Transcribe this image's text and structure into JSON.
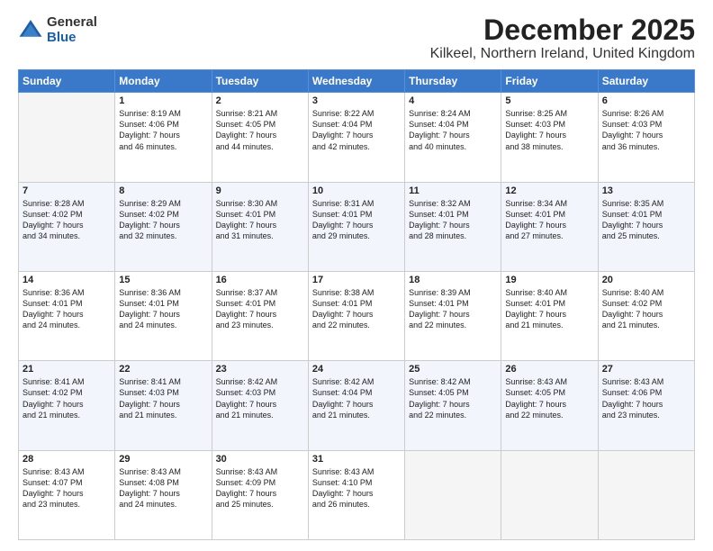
{
  "logo": {
    "general": "General",
    "blue": "Blue"
  },
  "header": {
    "title": "December 2025",
    "subtitle": "Kilkeel, Northern Ireland, United Kingdom"
  },
  "weekdays": [
    "Sunday",
    "Monday",
    "Tuesday",
    "Wednesday",
    "Thursday",
    "Friday",
    "Saturday"
  ],
  "weeks": [
    [
      {
        "day": "",
        "info": ""
      },
      {
        "day": "1",
        "info": "Sunrise: 8:19 AM\nSunset: 4:06 PM\nDaylight: 7 hours\nand 46 minutes."
      },
      {
        "day": "2",
        "info": "Sunrise: 8:21 AM\nSunset: 4:05 PM\nDaylight: 7 hours\nand 44 minutes."
      },
      {
        "day": "3",
        "info": "Sunrise: 8:22 AM\nSunset: 4:04 PM\nDaylight: 7 hours\nand 42 minutes."
      },
      {
        "day": "4",
        "info": "Sunrise: 8:24 AM\nSunset: 4:04 PM\nDaylight: 7 hours\nand 40 minutes."
      },
      {
        "day": "5",
        "info": "Sunrise: 8:25 AM\nSunset: 4:03 PM\nDaylight: 7 hours\nand 38 minutes."
      },
      {
        "day": "6",
        "info": "Sunrise: 8:26 AM\nSunset: 4:03 PM\nDaylight: 7 hours\nand 36 minutes."
      }
    ],
    [
      {
        "day": "7",
        "info": "Sunrise: 8:28 AM\nSunset: 4:02 PM\nDaylight: 7 hours\nand 34 minutes."
      },
      {
        "day": "8",
        "info": "Sunrise: 8:29 AM\nSunset: 4:02 PM\nDaylight: 7 hours\nand 32 minutes."
      },
      {
        "day": "9",
        "info": "Sunrise: 8:30 AM\nSunset: 4:01 PM\nDaylight: 7 hours\nand 31 minutes."
      },
      {
        "day": "10",
        "info": "Sunrise: 8:31 AM\nSunset: 4:01 PM\nDaylight: 7 hours\nand 29 minutes."
      },
      {
        "day": "11",
        "info": "Sunrise: 8:32 AM\nSunset: 4:01 PM\nDaylight: 7 hours\nand 28 minutes."
      },
      {
        "day": "12",
        "info": "Sunrise: 8:34 AM\nSunset: 4:01 PM\nDaylight: 7 hours\nand 27 minutes."
      },
      {
        "day": "13",
        "info": "Sunrise: 8:35 AM\nSunset: 4:01 PM\nDaylight: 7 hours\nand 25 minutes."
      }
    ],
    [
      {
        "day": "14",
        "info": "Sunrise: 8:36 AM\nSunset: 4:01 PM\nDaylight: 7 hours\nand 24 minutes."
      },
      {
        "day": "15",
        "info": "Sunrise: 8:36 AM\nSunset: 4:01 PM\nDaylight: 7 hours\nand 24 minutes."
      },
      {
        "day": "16",
        "info": "Sunrise: 8:37 AM\nSunset: 4:01 PM\nDaylight: 7 hours\nand 23 minutes."
      },
      {
        "day": "17",
        "info": "Sunrise: 8:38 AM\nSunset: 4:01 PM\nDaylight: 7 hours\nand 22 minutes."
      },
      {
        "day": "18",
        "info": "Sunrise: 8:39 AM\nSunset: 4:01 PM\nDaylight: 7 hours\nand 22 minutes."
      },
      {
        "day": "19",
        "info": "Sunrise: 8:40 AM\nSunset: 4:01 PM\nDaylight: 7 hours\nand 21 minutes."
      },
      {
        "day": "20",
        "info": "Sunrise: 8:40 AM\nSunset: 4:02 PM\nDaylight: 7 hours\nand 21 minutes."
      }
    ],
    [
      {
        "day": "21",
        "info": "Sunrise: 8:41 AM\nSunset: 4:02 PM\nDaylight: 7 hours\nand 21 minutes."
      },
      {
        "day": "22",
        "info": "Sunrise: 8:41 AM\nSunset: 4:03 PM\nDaylight: 7 hours\nand 21 minutes."
      },
      {
        "day": "23",
        "info": "Sunrise: 8:42 AM\nSunset: 4:03 PM\nDaylight: 7 hours\nand 21 minutes."
      },
      {
        "day": "24",
        "info": "Sunrise: 8:42 AM\nSunset: 4:04 PM\nDaylight: 7 hours\nand 21 minutes."
      },
      {
        "day": "25",
        "info": "Sunrise: 8:42 AM\nSunset: 4:05 PM\nDaylight: 7 hours\nand 22 minutes."
      },
      {
        "day": "26",
        "info": "Sunrise: 8:43 AM\nSunset: 4:05 PM\nDaylight: 7 hours\nand 22 minutes."
      },
      {
        "day": "27",
        "info": "Sunrise: 8:43 AM\nSunset: 4:06 PM\nDaylight: 7 hours\nand 23 minutes."
      }
    ],
    [
      {
        "day": "28",
        "info": "Sunrise: 8:43 AM\nSunset: 4:07 PM\nDaylight: 7 hours\nand 23 minutes."
      },
      {
        "day": "29",
        "info": "Sunrise: 8:43 AM\nSunset: 4:08 PM\nDaylight: 7 hours\nand 24 minutes."
      },
      {
        "day": "30",
        "info": "Sunrise: 8:43 AM\nSunset: 4:09 PM\nDaylight: 7 hours\nand 25 minutes."
      },
      {
        "day": "31",
        "info": "Sunrise: 8:43 AM\nSunset: 4:10 PM\nDaylight: 7 hours\nand 26 minutes."
      },
      {
        "day": "",
        "info": ""
      },
      {
        "day": "",
        "info": ""
      },
      {
        "day": "",
        "info": ""
      }
    ]
  ]
}
